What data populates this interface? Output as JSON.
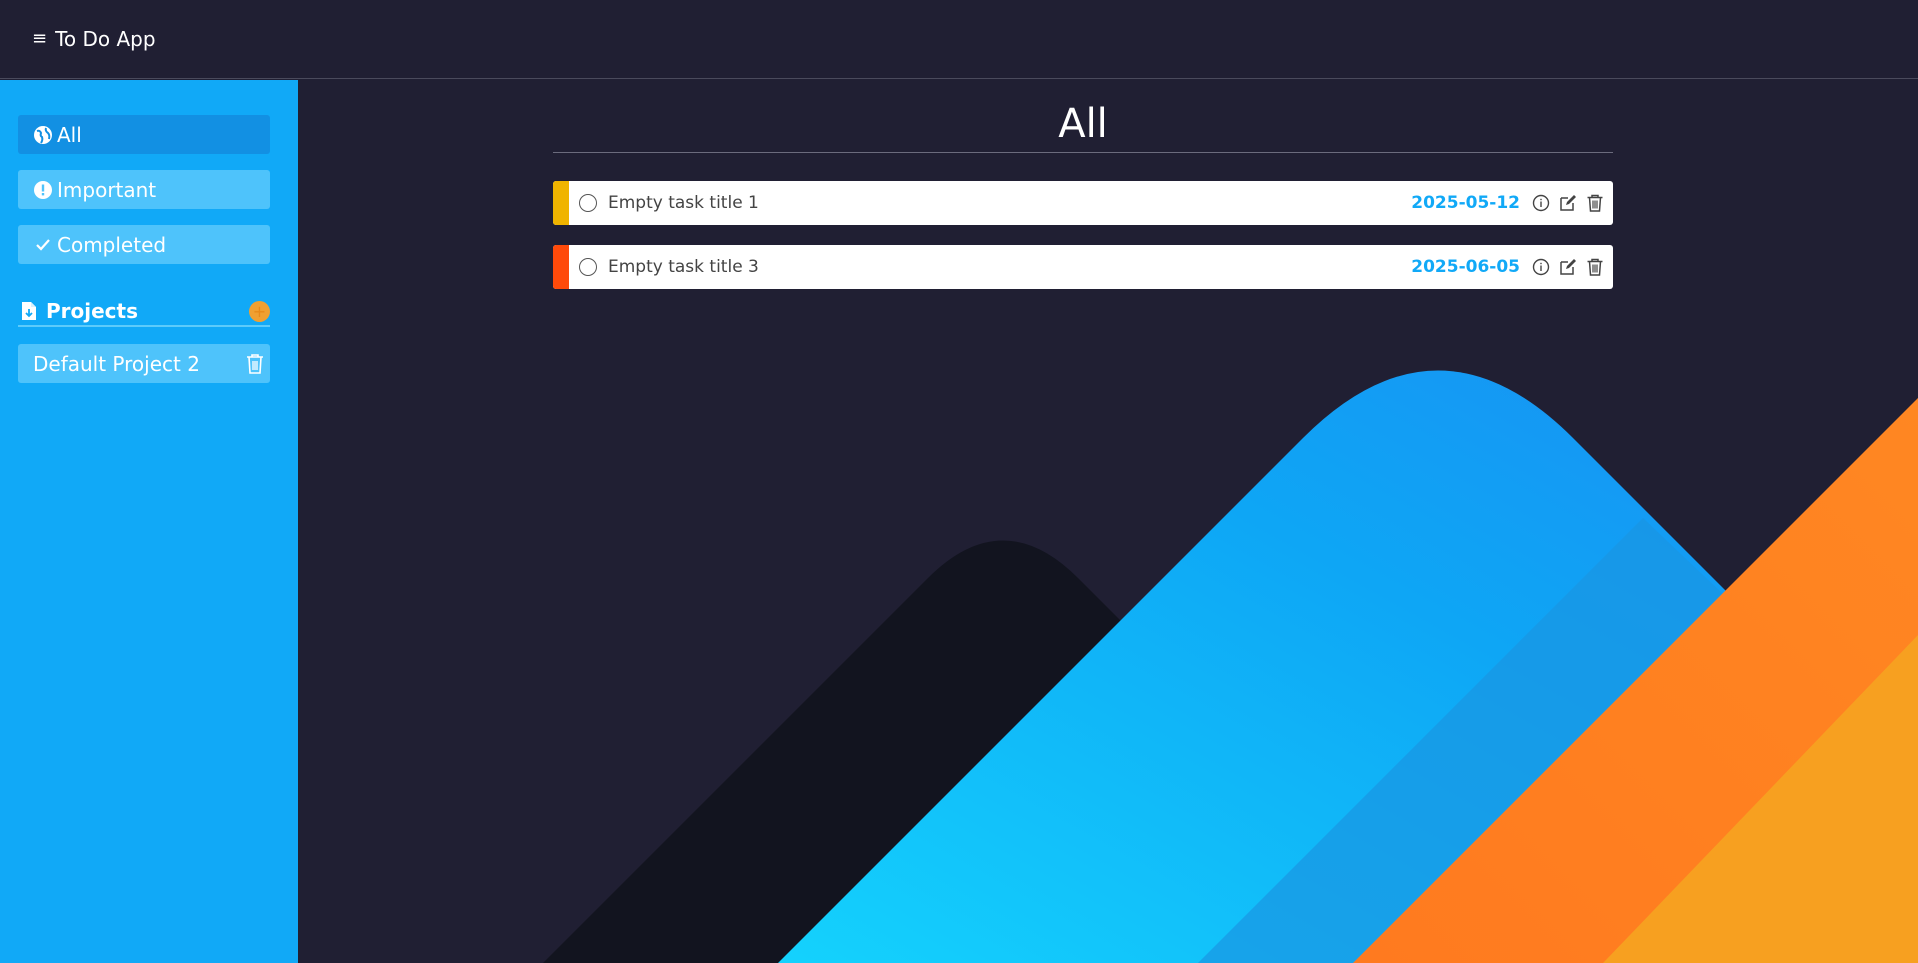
{
  "header": {
    "menu_icon": "hamburger-icon",
    "app_title": "To Do App"
  },
  "sidebar": {
    "nav": [
      {
        "label": "All",
        "icon": "globe-icon",
        "active": true
      },
      {
        "label": "Important",
        "icon": "exclamation-icon",
        "active": false
      },
      {
        "label": "Completed",
        "icon": "check-icon",
        "active": false
      }
    ],
    "projects_title": "Projects",
    "projects_icon": "document-icon",
    "add_icon": "plus-icon",
    "projects": [
      {
        "label": "Default Project 2",
        "icon": "trash-icon"
      }
    ]
  },
  "main": {
    "title": "All",
    "tasks": [
      {
        "title": "Empty task title 1",
        "date": "2025-05-12",
        "priority_color": "#f0b400"
      },
      {
        "title": "Empty task title 3",
        "date": "2025-06-05",
        "priority_color": "#ff4a0a"
      }
    ]
  },
  "colors": {
    "sidebar": "#11a9f7",
    "background": "#201f33",
    "accent": "#11a9f7"
  }
}
